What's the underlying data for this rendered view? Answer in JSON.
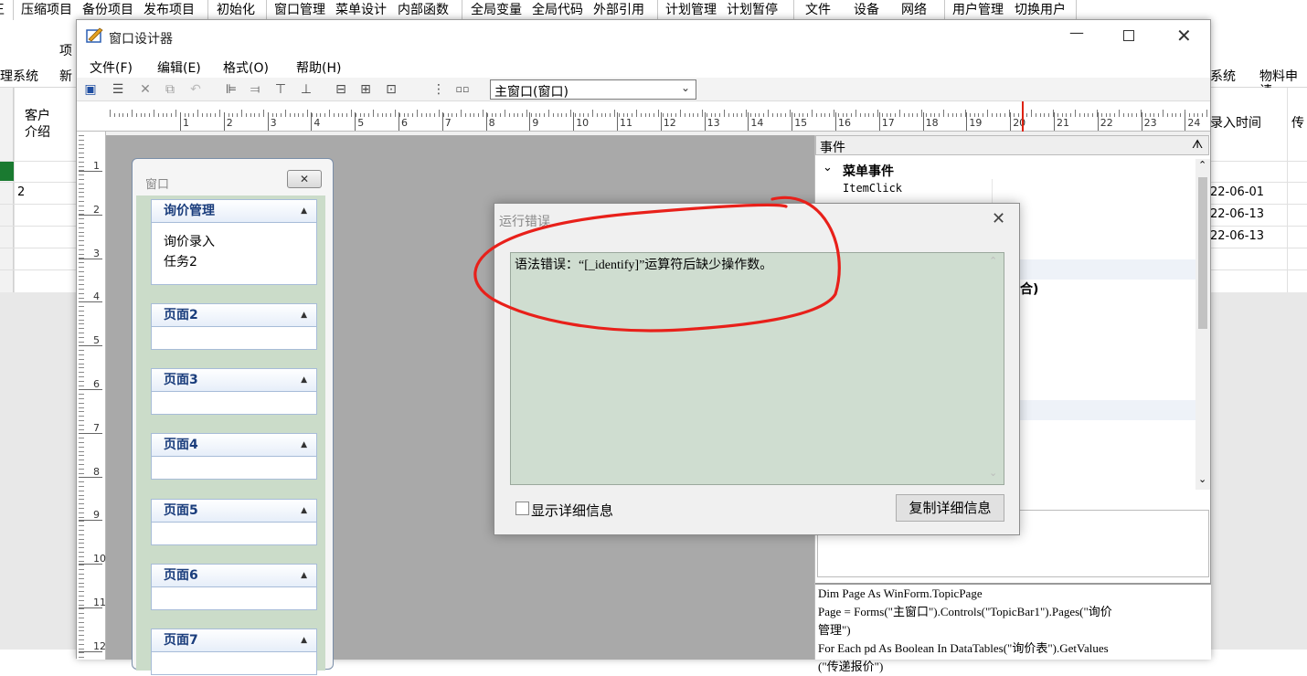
{
  "background_app": {
    "menu_items": [
      "压缩项目",
      "备份项目",
      "发布项目",
      "初始化",
      "窗口管理",
      "菜单设计",
      "内部函数",
      "全局变量",
      "全局代码",
      "外部引用",
      "计划管理",
      "计划暂停",
      "文件",
      "设备",
      "网络",
      "用户管理",
      "切换用户"
    ],
    "menu_prefix": "王",
    "ribbon_label_fragment": "项",
    "tabs_left": [
      "理系统",
      "新"
    ],
    "tabs_right": [
      "系统",
      "物料申请"
    ],
    "grid_headers": [
      "客户\n介绍",
      "录入时间",
      "传"
    ],
    "grid_rows": [
      {
        "num": "",
        "date": ""
      },
      {
        "num": "2",
        "date": "22-06-01"
      },
      {
        "num": "",
        "date": "22-06-13"
      },
      {
        "num": "",
        "date": "22-06-13"
      }
    ]
  },
  "designer": {
    "title": "窗口设计器",
    "menu": [
      {
        "label": "文件(F)"
      },
      {
        "label": "编辑(E)"
      },
      {
        "label": "格式(O)"
      },
      {
        "label": "帮助(H)"
      }
    ],
    "window_selector": "主窗口(窗口)",
    "ruler_h": [
      "1",
      "2",
      "3",
      "4",
      "5",
      "6",
      "7",
      "8",
      "9",
      "10",
      "11",
      "12",
      "13",
      "14",
      "15",
      "16",
      "17",
      "18",
      "19",
      "20",
      "21",
      "22",
      "23",
      "24"
    ],
    "ruler_v": [
      "1",
      "2",
      "3",
      "4",
      "5",
      "6",
      "7",
      "8",
      "9",
      "10",
      "11",
      "12"
    ]
  },
  "form_preview": {
    "title": "窗口",
    "sections": [
      {
        "title": "询价管理",
        "items": [
          "询价录入",
          "任务2"
        ]
      },
      {
        "title": "页面2",
        "items": []
      },
      {
        "title": "页面3",
        "items": []
      },
      {
        "title": "页面4",
        "items": []
      },
      {
        "title": "页面5",
        "items": []
      },
      {
        "title": "页面6",
        "items": []
      },
      {
        "title": "页面7",
        "items": []
      }
    ]
  },
  "events_panel": {
    "title": "事件",
    "pin": "ᗑ",
    "group": "菜单事件",
    "items": [
      "ItemClick"
    ],
    "partial_text": "合)",
    "code_lines": [
      "Dim Page As WinForm.TopicPage",
      "Page = Forms(\"主窗口\").Controls(\"TopicBar1\").Pages(\"询价",
      "管理\")",
      "For Each pd As Boolean In DataTables(\"询价表\").GetValues",
      "(\"传递报价\")"
    ]
  },
  "error_dialog": {
    "title": "运行错误",
    "message": "语法错误：“[_identify]”运算符后缺少操作数。",
    "show_details_label": "显示详细信息",
    "copy_button": "复制详细信息"
  },
  "colors": {
    "error_bg": "#cfddd0",
    "annotation": "#e8201a",
    "section_text": "#1a3d7c",
    "green_marker": "#1a7a30"
  }
}
